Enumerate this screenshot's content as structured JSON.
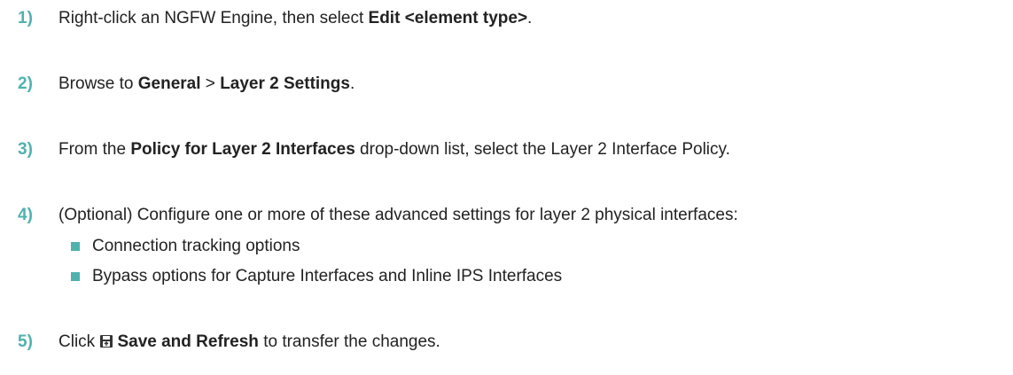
{
  "colors": {
    "accent": "#4fb2ae",
    "text": "#222222"
  },
  "steps": [
    {
      "num": "1)",
      "a": "Right-click an NGFW Engine, then select ",
      "b": "Edit <element type>",
      "c": "."
    },
    {
      "num": "2)",
      "a": "Browse to ",
      "b": "General",
      "c": " > ",
      "d": "Layer 2 Settings",
      "e": "."
    },
    {
      "num": "3)",
      "a": "From the ",
      "b": "Policy for Layer 2 Interfaces",
      "c": " drop-down list, select the Layer 2 Interface Policy."
    },
    {
      "num": "4)",
      "a": "(Optional) Configure one or more of these advanced settings for layer 2 physical interfaces:",
      "bullets": [
        "Connection tracking options",
        "Bypass options for Capture Interfaces and Inline IPS Interfaces"
      ]
    },
    {
      "num": "5)",
      "a": "Click ",
      "icon": "save-icon",
      "b": "Save and Refresh",
      "c": " to transfer the changes."
    }
  ]
}
